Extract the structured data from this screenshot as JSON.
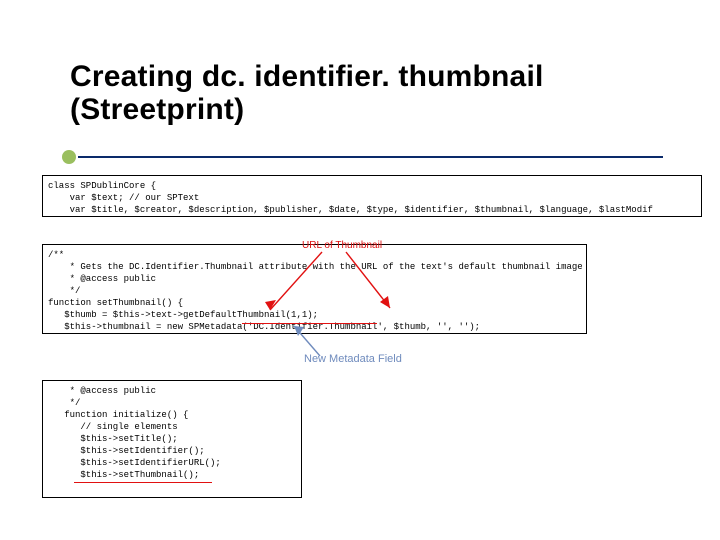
{
  "title": "Creating dc. identifier. thumbnail\n(Streetprint)",
  "code_box_1": "class SPDublinCore {\n    var $text; // our SPText\n    var $title, $creator, $description, $publisher, $date, $type, $identifier, $thumbnail, $language, $lastModif",
  "code_box_2": "/**\n    * Gets the DC.Identifier.Thumbnail attribute with the URL of the text's default thumbnail image\n    * @access public\n    */\nfunction setThumbnail() {\n   $thumb = $this->text->getDefaultThumbnail(1,1);\n   $this->thumbnail = new SPMetadata('DC.Identifier.Thumbnail', $thumb, '', '');\n}",
  "code_box_3": "    * @access public\n    */\n   function initialize() {\n      // single elements\n      $this->setTitle();\n      $this->setIdentifier();\n      $this->setIdentifierURL();\n      $this->setThumbnail();",
  "annotation_url": "URL of Thumbnail",
  "annotation_new": "New Metadata Field"
}
